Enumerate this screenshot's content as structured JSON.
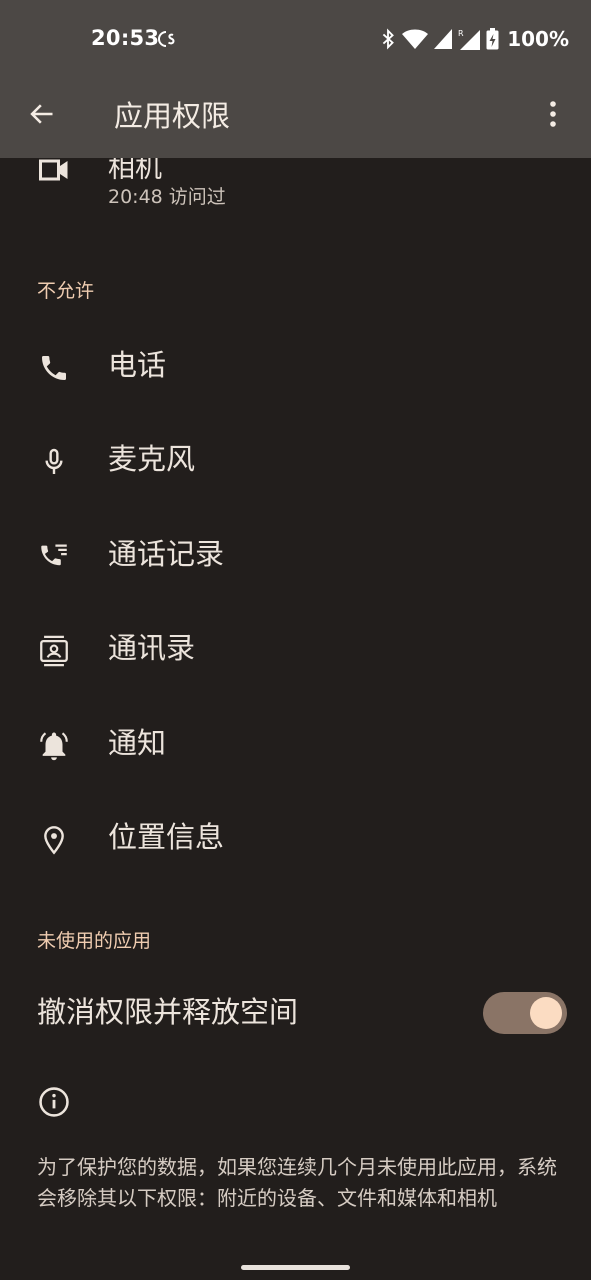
{
  "status_bar": {
    "time": "20:53",
    "battery": "100%",
    "icons": [
      "notification-app-icon",
      "bluetooth-icon",
      "wifi-icon",
      "cell-signal-icon",
      "roaming-signal-icon",
      "battery-charging-icon"
    ]
  },
  "app_bar": {
    "title": "应用权限",
    "back_icon": "arrow-back-icon",
    "more_icon": "more-vert-icon"
  },
  "allowed_partial": {
    "label": "相机",
    "subtitle": "20:48 访问过",
    "icon": "videocam-icon"
  },
  "denied_section": {
    "header": "不允许",
    "items": [
      {
        "label": "电话",
        "icon": "phone-icon"
      },
      {
        "label": "麦克风",
        "icon": "mic-icon"
      },
      {
        "label": "通话记录",
        "icon": "call-log-icon"
      },
      {
        "label": "通讯录",
        "icon": "contacts-icon"
      },
      {
        "label": "通知",
        "icon": "notifications-icon"
      },
      {
        "label": "位置信息",
        "icon": "location-icon"
      }
    ]
  },
  "unused_section": {
    "header": "未使用的应用",
    "toggle_label": "撤消权限并释放空间",
    "toggle_on": true,
    "info_icon": "info-icon",
    "info_text": "为了保护您的数据，如果您连续几个月未使用此应用，系统会移除其以下权限：附近的设备、文件和媒体和相机"
  },
  "colors": {
    "background": "#221e1c",
    "app_bar": "#4c4845",
    "accent": "#f0cdb1",
    "toggle_track": "#8a7466",
    "toggle_thumb": "#fbdcc2"
  }
}
